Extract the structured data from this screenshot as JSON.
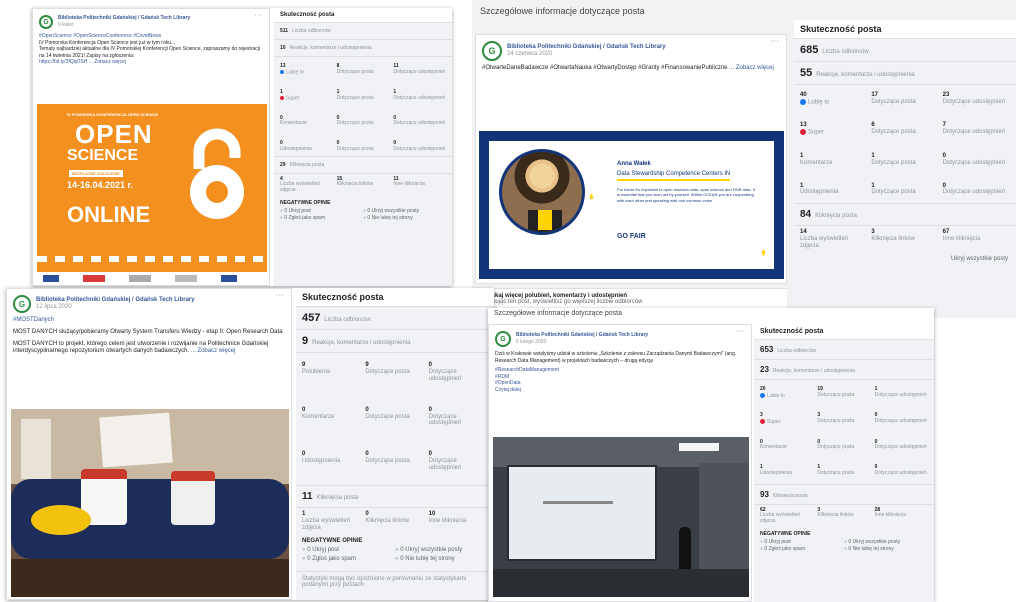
{
  "page": "Biblioteka Politechniki Gdańskiej / Gdańsk Tech Library",
  "logo_letter": "G",
  "menu_icon": "more-dots-icon",
  "colors": {
    "brand_link": "#385898",
    "orange": "#f39020",
    "navy": "#14347a",
    "like": "#1877f2",
    "love": "#e41e3f"
  },
  "post1": {
    "date": "9 kwiet",
    "text": [
      "#OpenScience #OpenScienceConference #CovidNews",
      "IV Pomorska Konferencja Open Science jest już w tym roku...",
      "Tematy najbardziej aktualne dla IV Pomorskiej Konferencji Open Science, zapraszamy do rejestracji na 14 kwietnia 2021! Zapisy na zgłoszenia:",
      "https://bit.ly/3fQqOSH"
    ],
    "more": "... Zobacz więcej",
    "banner": {
      "open": "OPEN",
      "science": "SCIENCE",
      "sub": "IV POMORSKA KONFERENCJA OPEN SCIENCE",
      "mid": "BEZPŁATNE SZKOLENIE",
      "dates": "14-16.04.2021 r.",
      "online": "ONLINE",
      "icon": "open-access-lock-icon"
    },
    "stats": {
      "title": "Skuteczność posta",
      "reach": "511",
      "reach_label": "Liczba odbiorców",
      "eng": "10",
      "eng_label": "Reakcje, komentarze i udostępnienia",
      "rows": [
        [
          "13",
          "Lubię to",
          "8",
          "Dotyczące posta",
          "11",
          "Dotyczące udostępnień"
        ],
        [
          "1",
          "Super",
          "1",
          "Dotyczące posta",
          "1",
          "Dotyczące udostępnień"
        ],
        [
          "0",
          "Komentarze",
          "0",
          "Dotyczące posta",
          "0",
          "Dotyczące udostępnień"
        ],
        [
          "0",
          "Udostępnienia",
          "0",
          "Dotyczące posta",
          "0",
          "Dotyczące udostępnień"
        ]
      ],
      "clicks": "29",
      "clicks_label": "Kliknięcia posta",
      "click_cells": [
        "4",
        "Liczba wyświetleń zdjęcia",
        "15",
        "Kliknięcia linków",
        "11",
        "Inne kliknięcia"
      ],
      "neg_title": "NEGATYWNE OPINIE",
      "neg": [
        "0 Ukryj post",
        "0 Ukryj wszystkie posty",
        "0 Zgłoś jako spam",
        "0 Nie lubię tej strony"
      ]
    }
  },
  "post2": {
    "caption": "Szczegółowe informacje dotyczące posta",
    "date": "24 czerwca 2020",
    "tags": [
      "#OtwarteDaneBadawcze",
      "#OtwartaNauka",
      "#OtwartyDostęp",
      "#Granty",
      "#FinansowaniePubliczne"
    ],
    "more": "... Zobacz więcej",
    "card_name": "Anna Wałek",
    "card_role": "Data Stewardship Competence Centers IN",
    "card_quote": "For future it's important to open research data, open science and FAIR data. It is essential that you don't act by yourself. Within OCEAN you are cooperating with each other and speaking with one common voice.",
    "card_logo": "GO FAIR",
    "cta_title": "Uzyskaj więcej polubień, komentarzy i udostępnień",
    "cta_text": "Promując ten post, wyświetlisz go większej liczbie odbiorców",
    "stats": {
      "title": "Skuteczność posta",
      "reach": "685",
      "reach_label": "Liczba odbiorców",
      "eng": "55",
      "eng_label": "Reakcje, komentarze i udostępnienia",
      "rows": [
        [
          "40",
          "Lubię to",
          "17",
          "Dotyczące posta",
          "23",
          "Dotyczące udostępnień"
        ],
        [
          "13",
          "Super",
          "6",
          "Dotyczące posta",
          "7",
          "Dotyczące udostępnień"
        ],
        [
          "1",
          "Komentarze",
          "1",
          "Dotyczące posta",
          "0",
          "Dotyczące udostępnień"
        ],
        [
          "1",
          "Udostępnienia",
          "1",
          "Dotyczące posta",
          "0",
          "Dotyczące udostępnień"
        ]
      ],
      "clicks": "84",
      "clicks_label": "Kliknięcia posta",
      "click_cells": [
        "14",
        "Liczba wyświetleń zdjęcia",
        "3",
        "Kliknięcia linków",
        "67",
        "Inne kliknięcia"
      ],
      "neg_partial": "Ukryj wszystkie posty"
    }
  },
  "post3": {
    "date": "12 lipca 2020",
    "tag": "#MOSTDanych",
    "text": [
      "MOST DANYCH służący/pobieramy Otwarty System Transferu Wiedzy - etap II: Open Research Data",
      "MOST DANYCH to projekt, którego celem jest utworzenie i rozwijanie na Politechnice Gdańskiej interdyscyplinarnego repozytorium otwartych danych badawczych."
    ],
    "more": "... Zobacz więcej",
    "stats": {
      "title": "Skuteczność posta",
      "reach": "457",
      "reach_label": "Liczba odbiorców",
      "eng": "9",
      "eng_label": "Reakcje, komentarze i udostępnienia",
      "rows": [
        [
          "9",
          "Polubienia",
          "9",
          "Dotyczące posta",
          "0",
          "Dotyczące udostępnień"
        ],
        [
          "0",
          "Komentarze",
          "0",
          "Dotyczące posta",
          "0",
          "Dotyczące udostępnień"
        ],
        [
          "0",
          "Udostępnienia",
          "0",
          "Dotyczące posta",
          "0",
          "Dotyczące udostępnień"
        ]
      ],
      "clicks": "11",
      "clicks_label": "Kliknięcia posta",
      "click_cells": [
        "1",
        "Liczba wyświetleń zdjęcia",
        "0",
        "Kliknięcia linków",
        "10",
        "Inne kliknięcia"
      ],
      "neg_title": "NEGATYWNE OPINIE",
      "neg": [
        "0 Ukryj post",
        "0 Ukryj wszystkie posty",
        "0 Zgłoś jako spam",
        "0 Nie lubię tej strony"
      ],
      "footer": "Statystyki mogą być opóźnione w porównaniu ze statystykami podanymi przy postach"
    }
  },
  "post4": {
    "caption": "Szczegółowe informacje dotyczące posta",
    "date": "6 lutego 2020",
    "text": [
      "Dziś w Krakowie wzięłyśmy udział w szkoleniu „Szkolenie z zakresu Zarządzania Danymi Badawczymi” (ang. Research Data Management) w projektach badawczych – drugą edycję"
    ],
    "tags": [
      "#ResearchDataManagement",
      "#RDM",
      "#OpenData"
    ],
    "more": "Czytaj dalej",
    "stats": {
      "title": "Skuteczność posta",
      "reach": "653",
      "reach_label": "Liczba odbiorców",
      "eng": "23",
      "eng_label": "Reakcje, komentarze i udostępnienia",
      "rows": [
        [
          "20",
          "Lubię to",
          "19",
          "Dotyczące posta",
          "1",
          "Dotyczące udostępnień"
        ],
        [
          "3",
          "Super",
          "3",
          "Dotyczące posta",
          "0",
          "Dotyczące udostępnień"
        ],
        [
          "0",
          "Komentarze",
          "0",
          "Dotyczące posta",
          "0",
          "Dotyczące udostępnień"
        ],
        [
          "1",
          "Udostępnienia",
          "1",
          "Dotyczące posta",
          "0",
          "Dotyczące udostępnień"
        ]
      ],
      "clicks": "93",
      "clicks_label": "Kliknięcia posta",
      "click_cells": [
        "62",
        "Liczba wyświetleń zdjęcia",
        "3",
        "Kliknięcia linków",
        "28",
        "Inne kliknięcia"
      ],
      "neg_title": "NEGATYWNE OPINIE",
      "neg": [
        "0 Ukryj post",
        "0 Ukryj wszystkie posty",
        "0 Zgłoś jako spam",
        "0 Nie lubię tej strony"
      ]
    }
  }
}
